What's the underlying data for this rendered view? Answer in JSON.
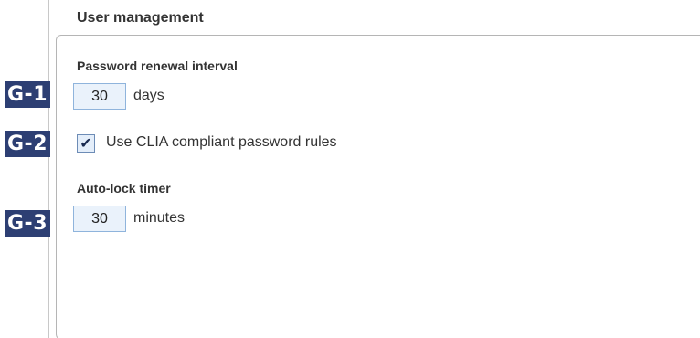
{
  "section": {
    "title": "User management"
  },
  "password_renewal": {
    "label": "Password renewal interval",
    "value": "30",
    "unit": "days",
    "badge": "G-1"
  },
  "clia_rules": {
    "label": "Use CLIA compliant password rules",
    "checked": true,
    "check_glyph": "✔",
    "badge": "G-2"
  },
  "auto_lock": {
    "label": "Auto-lock timer",
    "value": "30",
    "unit": "minutes",
    "badge": "G-3"
  },
  "colors": {
    "badge_bg": "#2d3f73",
    "input_bg": "#eaf2fb",
    "input_border": "#8fb4dc"
  }
}
